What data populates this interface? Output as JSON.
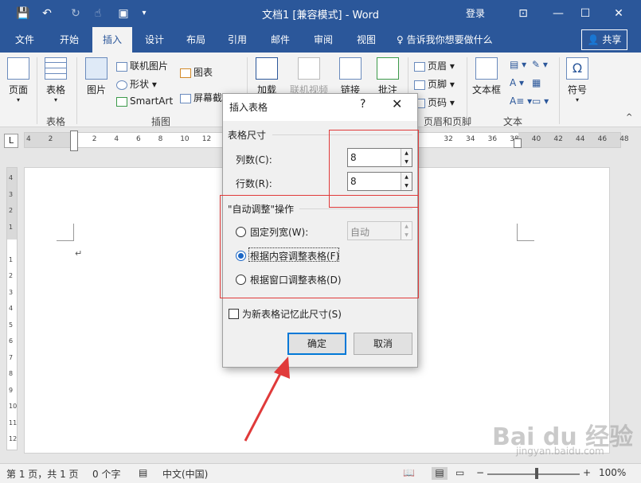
{
  "titlebar": {
    "title": "文档1 [兼容模式] - Word",
    "login": "登录",
    "bg_color": "#2b579a"
  },
  "tabs": [
    "文件",
    "开始",
    "插入",
    "设计",
    "布局",
    "引用",
    "邮件",
    "审阅",
    "视图"
  ],
  "active_tab": "插入",
  "tell_me": "♀ 告诉我你想要做什么",
  "share": "共享",
  "ribbon": {
    "page_btn": "页面",
    "table_btn": "表格",
    "pictures_btn": "图片",
    "online_pictures": "联机图片",
    "shapes": "形状",
    "smartart": "SmartArt",
    "chart": "图表",
    "screenshot": "屏幕截图",
    "addins": "加载",
    "online_video": "联机视频",
    "links": "链接",
    "comment": "批注",
    "header": "页眉",
    "footer": "页脚",
    "page_number": "页码",
    "textbox": "文本框",
    "symbol": "符号",
    "groups": {
      "tables": "表格",
      "illustrations": "插图",
      "header_footer": "页眉和页脚",
      "text": "文本"
    }
  },
  "ruler": {
    "tab_selector": "L",
    "ticks": [
      "4",
      "2",
      "",
      "2",
      "4",
      "6",
      "8",
      "10",
      "12",
      "",
      "",
      "",
      "",
      "",
      "",
      "",
      "",
      "",
      "",
      "32",
      "34",
      "36",
      "38",
      "40",
      "42",
      "44",
      "46",
      "48"
    ]
  },
  "vruler_ticks": [
    "4",
    "3",
    "2",
    "1",
    "",
    "1",
    "2",
    "3",
    "4",
    "5",
    "6",
    "7",
    "8",
    "9",
    "10",
    "11",
    "12"
  ],
  "document": {
    "paragraph_mark": "↵"
  },
  "dialog": {
    "title": "插入表格",
    "help": "?",
    "close": "✕",
    "size_section": "表格尺寸",
    "columns_label": "列数(C):",
    "columns_value": "8",
    "rows_label": "行数(R):",
    "rows_value": "8",
    "autofit_section": "\"自动调整\"操作",
    "fixed_width_label": "固定列宽(W):",
    "fixed_width_value": "自动",
    "autofit_contents_label": "根据内容调整表格(F)",
    "autofit_window_label": "根据窗口调整表格(D)",
    "remember_label": "为新表格记忆此尺寸(S)",
    "ok": "确定",
    "cancel": "取消",
    "selected_option": "autofit_contents"
  },
  "statusbar": {
    "page": "第 1 页，共 1 页",
    "words": "0 个字",
    "language": "中文(中国)",
    "zoom": "100%"
  },
  "annotation_color": "#e03a3a",
  "watermark": "Bai du 经验",
  "watermark_url": "jingyan.baidu.com"
}
